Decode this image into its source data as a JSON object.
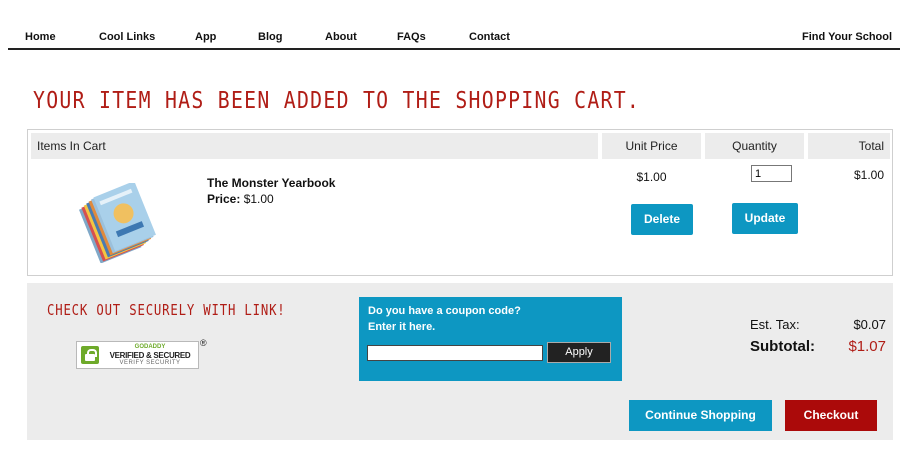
{
  "nav": {
    "items": [
      "Home",
      "Cool Links",
      "App",
      "Blog",
      "About",
      "FAQs",
      "Contact"
    ],
    "find_school": "Find Your School"
  },
  "headline": "Your item has been added to the shopping cart.",
  "cart": {
    "headers": {
      "items": "Items In Cart",
      "unit_price": "Unit Price",
      "quantity": "Quantity",
      "total": "Total"
    },
    "item": {
      "name": "The Monster Yearbook",
      "price_label": "Price:",
      "price": "$1.00",
      "unit_price": "$1.00",
      "quantity": "1",
      "total": "$1.00",
      "image_icon": "yearbook-stack-image"
    },
    "delete_label": "Delete",
    "update_label": "Update"
  },
  "checkout": {
    "secure_title": "Check out securely with Link!",
    "seal": {
      "line1": "GODADDY",
      "line2": "VERIFIED & SECURED",
      "line3": "VERIFY SECURITY",
      "reg": "®"
    },
    "coupon": {
      "line1": "Do you have a coupon code?",
      "line2": "Enter it here.",
      "value": "",
      "apply_label": "Apply"
    },
    "tax_label": "Est. Tax:",
    "tax_value": "$0.07",
    "subtotal_label": "Subtotal:",
    "subtotal_value": "$1.07",
    "continue_label": "Continue Shopping",
    "checkout_label": "Checkout"
  },
  "colors": {
    "accent_blue": "#0d97c2",
    "accent_red": "#b01d16",
    "checkout_red": "#ab0a0a",
    "panel_gray": "#ececec"
  }
}
